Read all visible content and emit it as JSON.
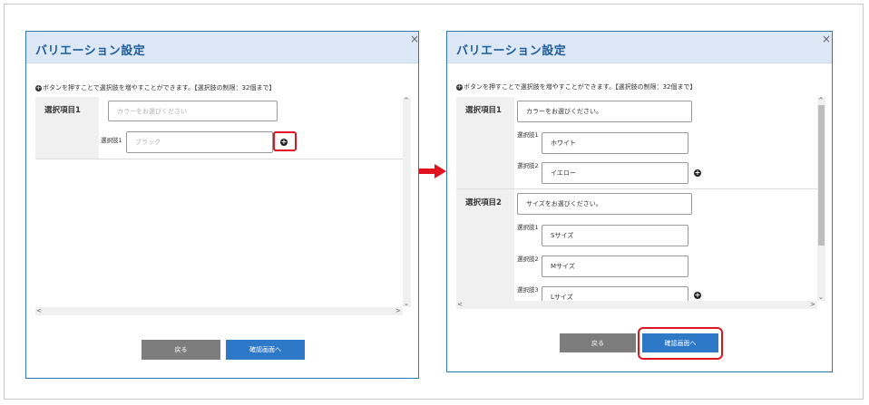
{
  "dialog_title": "バリエーション設定",
  "close_symbol": "×",
  "instruction": "ボタンを押すことで選択肢を増やすことができます。【選択肢の制限：32個まで】",
  "instruction_bullet": "+",
  "plus_symbol": "+",
  "scroll_up": "^",
  "scroll_down": "⌄",
  "scroll_left": "<",
  "scroll_right": ">",
  "left": {
    "groups": [
      {
        "label": "選択項目1",
        "select_placeholder": "カラーをお選びください",
        "options": [
          {
            "label": "選択肢1",
            "placeholder": "ブラック"
          }
        ]
      }
    ],
    "back_label": "戻る",
    "confirm_label": "確認画面へ"
  },
  "right": {
    "groups": [
      {
        "label": "選択項目1",
        "select_value": "カラーをお選びください。",
        "options": [
          {
            "label": "選択肢1",
            "value": "ホワイト"
          },
          {
            "label": "選択肢2",
            "value": "イエロー"
          }
        ]
      },
      {
        "label": "選択項目2",
        "select_value": "サイズをお選びください。",
        "options": [
          {
            "label": "選択肢1",
            "value": "Sサイズ"
          },
          {
            "label": "選択肢2",
            "value": "Mサイズ"
          },
          {
            "label": "選択肢3",
            "value": "Lサイズ"
          }
        ]
      }
    ],
    "back_label": "戻る",
    "confirm_label": "確認画面へ"
  },
  "colors": {
    "title_text": "#1e5b9a",
    "titlebar_bg": "#dce8f6",
    "dialog_border": "#2e78b8",
    "back_button": "#7d7d7d",
    "confirm_button": "#2e78c8",
    "highlight": "#e0141e",
    "arrow": "#e0141e"
  }
}
